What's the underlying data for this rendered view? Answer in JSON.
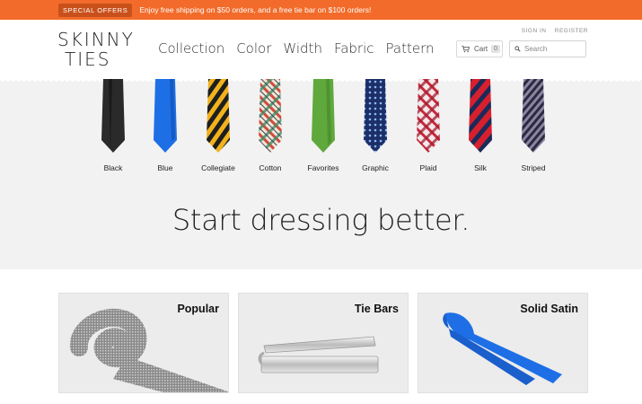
{
  "promo": {
    "badge": "SPECIAL OFFERS",
    "text": "Enjoy free shipping on $50 orders, and a free tie bar on $100 orders!"
  },
  "header": {
    "logo_line1": "SKINNY",
    "logo_line2": "TIES",
    "nav": [
      "Collection",
      "Color",
      "Width",
      "Fabric",
      "Pattern"
    ],
    "sign_in": "SIGN IN",
    "register": "REGISTER",
    "cart_label": "Cart",
    "cart_count": "0",
    "search_placeholder": "Search"
  },
  "hero": {
    "ties": [
      {
        "label": "Black",
        "icon": "black-tie-icon"
      },
      {
        "label": "Blue",
        "icon": "blue-tie-icon"
      },
      {
        "label": "Collegiate",
        "icon": "collegiate-tie-icon"
      },
      {
        "label": "Cotton",
        "icon": "cotton-tie-icon"
      },
      {
        "label": "Favorites",
        "icon": "favorites-tie-icon"
      },
      {
        "label": "Graphic",
        "icon": "graphic-tie-icon"
      },
      {
        "label": "Plaid",
        "icon": "plaid-tie-icon"
      },
      {
        "label": "Silk",
        "icon": "silk-tie-icon"
      },
      {
        "label": "Striped",
        "icon": "striped-tie-icon"
      }
    ],
    "headline": "Start dressing better."
  },
  "cards": [
    {
      "title": "Popular"
    },
    {
      "title": "Tie Bars"
    },
    {
      "title": "Solid Satin"
    }
  ],
  "colors": {
    "promo_bg": "#f26b2a",
    "blue": "#1e6fe6",
    "green": "#5fa83c"
  }
}
